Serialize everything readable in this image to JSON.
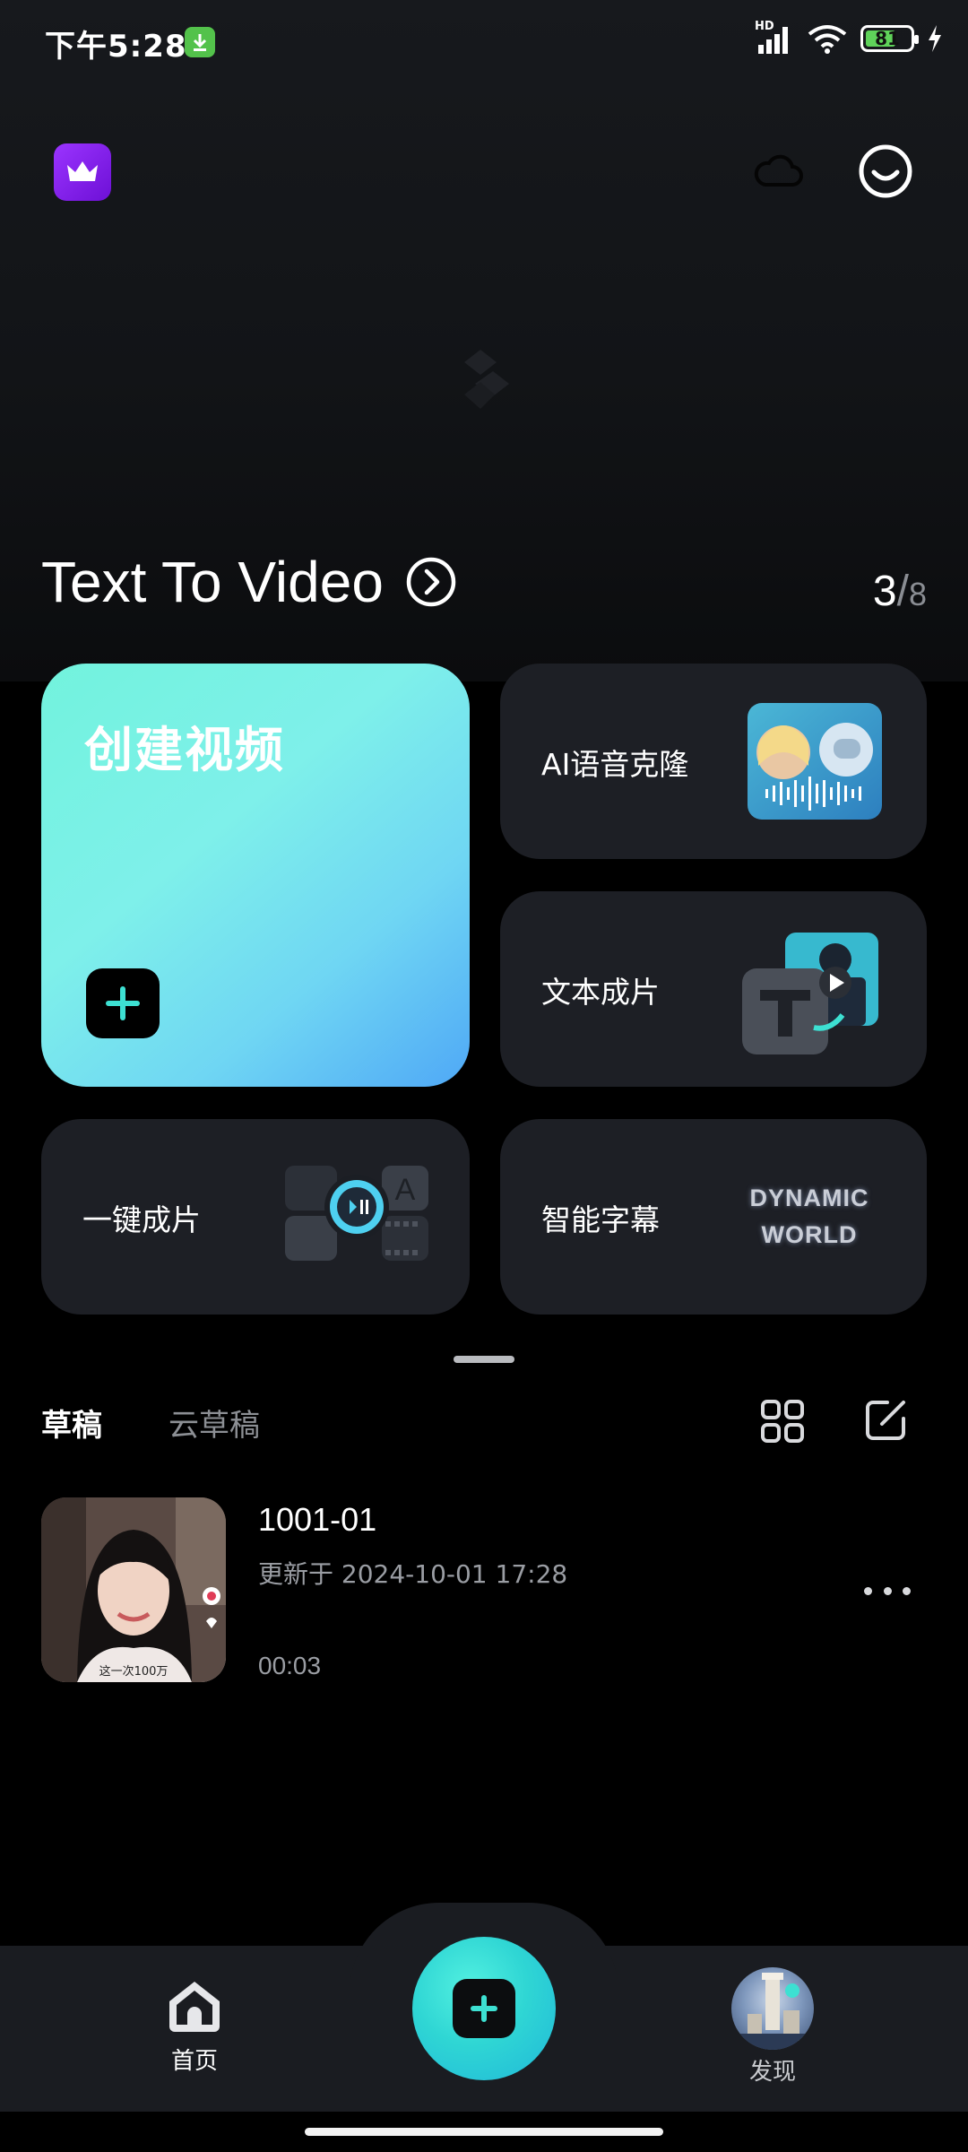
{
  "status_bar": {
    "time": "下午5:28",
    "network_label": "HD",
    "battery_level": "81",
    "colors": {
      "battery_fill": "#5fd35a",
      "download_badge": "#53c24b"
    }
  },
  "header": {
    "vip_icon": "crown-icon",
    "cloud_icon": "cloud-icon",
    "profile_icon": "smiley-icon"
  },
  "text_to_video": {
    "title": "Text To Video",
    "current_page": "3",
    "separator": "/",
    "total_pages": "8"
  },
  "feature_cards": {
    "create": {
      "label": "创建视频"
    },
    "ai_voice_clone": {
      "label": "AI语音克隆"
    },
    "text_to_film": {
      "label": "文本成片"
    },
    "one_click": {
      "label": "一键成片"
    },
    "smart_subtitles": {
      "label": "智能字幕",
      "preview_line1": "DYNAMIC",
      "preview_line2": "WORLD"
    }
  },
  "drafts": {
    "tabs": [
      "草稿",
      "云草稿"
    ],
    "active_tab": "草稿",
    "items": [
      {
        "name": "1001-01",
        "updated": "更新于 2024-10-01 17:28",
        "duration": "00:03",
        "thumb_caption": "这一次100万"
      }
    ]
  },
  "bottom_nav": {
    "home_label": "首页",
    "discover_label": "发现",
    "accent": "#2fd6d4"
  }
}
